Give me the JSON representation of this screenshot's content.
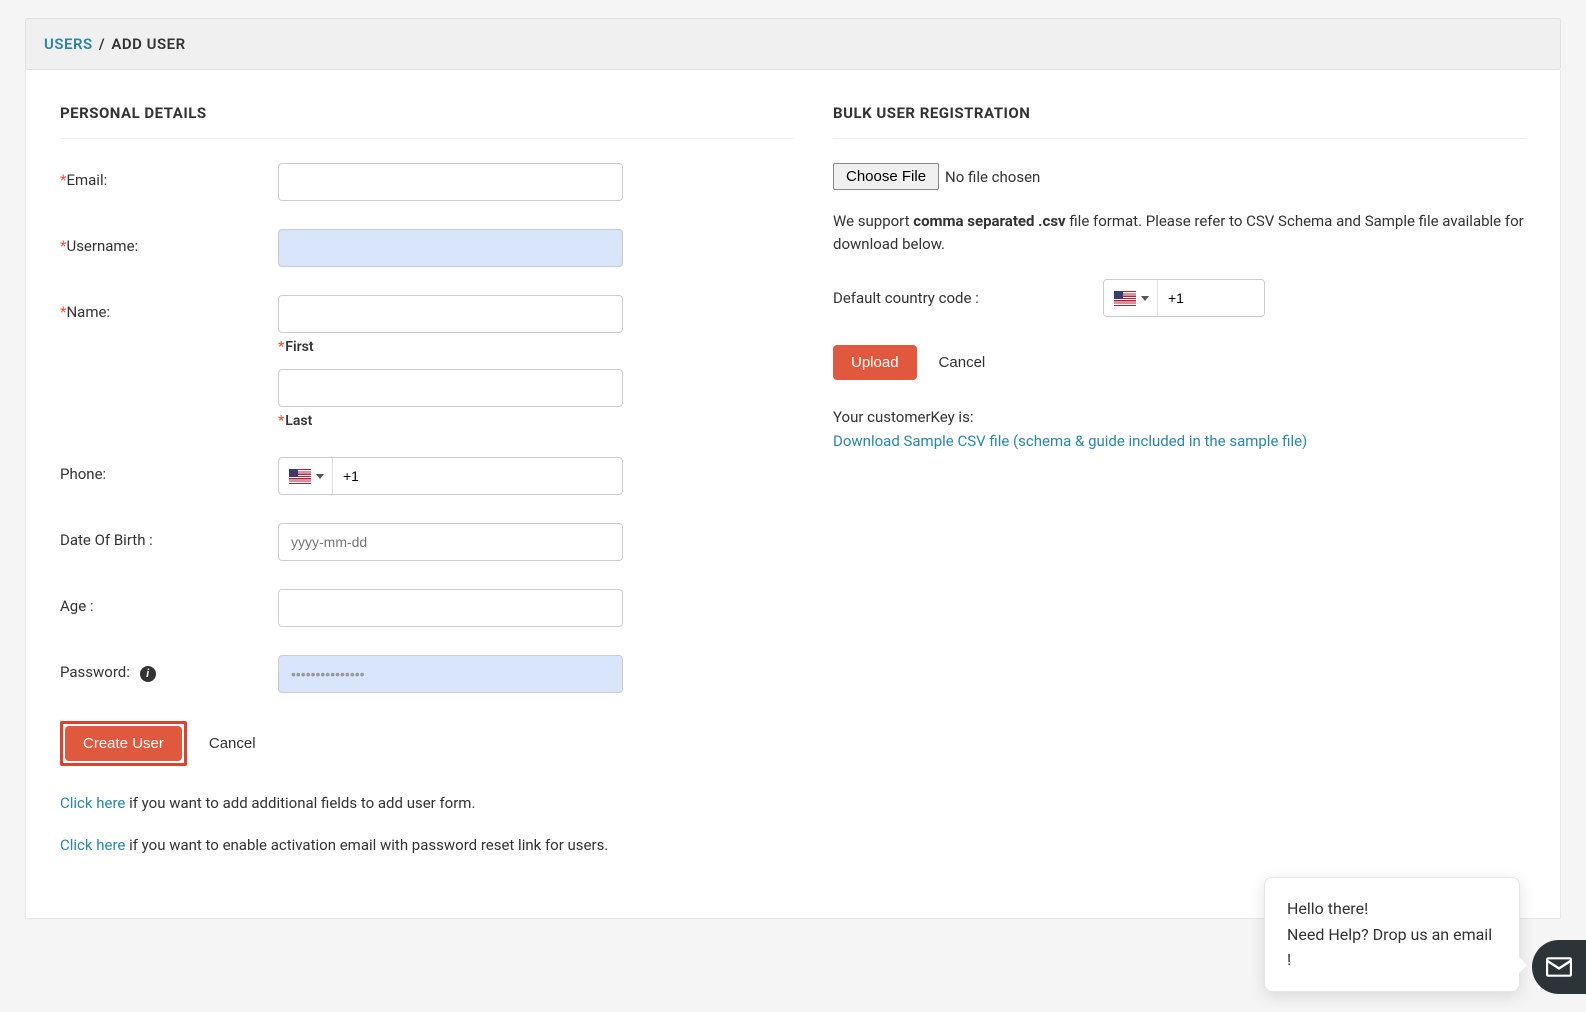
{
  "breadcrumb": {
    "root": "USERS",
    "sep": "/",
    "current": "ADD USER"
  },
  "left": {
    "section_title": "PERSONAL DETAILS",
    "labels": {
      "email": "Email:",
      "username": "Username:",
      "name": "Name:",
      "first": "First",
      "last": "Last",
      "phone": "Phone:",
      "dob": "Date Of Birth :",
      "age": "Age :",
      "password": "Password:"
    },
    "values": {
      "email": "",
      "username": "",
      "first": "",
      "last": "",
      "phone_code": "+1",
      "dob": "",
      "dob_placeholder": "yyyy-mm-dd",
      "age": "",
      "password": "•••••••••••••••"
    },
    "buttons": {
      "create": "Create User",
      "cancel": "Cancel"
    },
    "help1_link": "Click here",
    "help1_rest": " if you want to add additional fields to add user form.",
    "help2_link": "Click here",
    "help2_rest": " if you want to enable activation email with password reset link for users."
  },
  "right": {
    "section_title": "BULK USER REGISTRATION",
    "choose_file": "Choose File",
    "no_file": "No file chosen",
    "support_pre": "We support ",
    "support_bold": "comma separated .csv",
    "support_post": " file format. Please refer to CSV Schema and Sample file available for download below.",
    "default_cc_label": "Default country code :",
    "default_cc_value": "+1",
    "upload": "Upload",
    "cancel": "Cancel",
    "customerkey_label": "Your customerKey is:",
    "customerkey_value": "",
    "download_link": "Download Sample CSV file (schema & guide included in the sample file)"
  },
  "chat": {
    "line1": "Hello there!",
    "line2": "Need Help? Drop us an email !"
  }
}
